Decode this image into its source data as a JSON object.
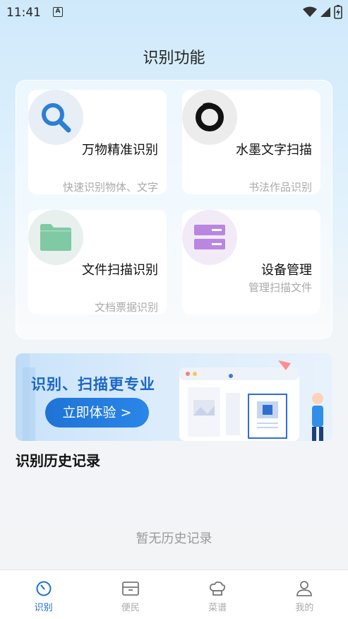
{
  "status_bar": {
    "time": "11:41",
    "notification_badge": "A"
  },
  "page_title": "识别功能",
  "features": [
    {
      "title": "万物精准识别",
      "subtitle": "快速识别物体、文字",
      "icon": "search-icon",
      "icon_bg": "#e7eef6",
      "icon_color": "#2b7fd4"
    },
    {
      "title": "水墨文字扫描",
      "subtitle": "书法作品识别",
      "icon": "ink-circle-icon",
      "icon_bg": "#ececec",
      "icon_color": "#111111"
    },
    {
      "title": "文件扫描识别",
      "subtitle": "文档票据识别",
      "icon": "folder-icon",
      "icon_bg": "#e7f0ec",
      "icon_color": "#7fc9a4"
    },
    {
      "title": "设备管理",
      "subtitle": "管理扫描文件",
      "icon": "device-list-icon",
      "icon_bg": "#f3eaf8",
      "icon_color": "#b986e0"
    }
  ],
  "banner": {
    "title": "识别、扫描更专业",
    "button_label": "立即体验 >"
  },
  "history": {
    "title": "识别历史记录",
    "empty_text": "暂无历史记录"
  },
  "tabs": [
    {
      "label": "识别",
      "icon": "recognize-icon",
      "active": true
    },
    {
      "label": "便民",
      "icon": "box-icon",
      "active": false
    },
    {
      "label": "菜谱",
      "icon": "chef-hat-icon",
      "active": false
    },
    {
      "label": "我的",
      "icon": "user-icon",
      "active": false
    }
  ],
  "colors": {
    "accent": "#1e6fd0",
    "inactive": "#aaaaaa"
  }
}
